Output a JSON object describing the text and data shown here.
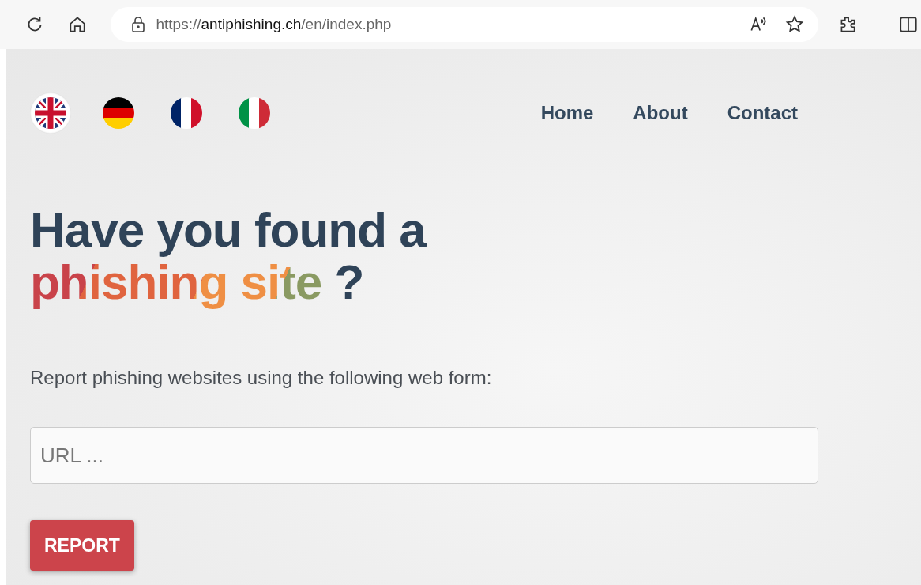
{
  "browser": {
    "url": {
      "scheme": "https://",
      "host": "antiphishing.ch",
      "path": "/en/index.php"
    }
  },
  "languages": [
    {
      "kind": "union",
      "selected": true
    },
    {
      "kind": "horizontal",
      "selected": false
    },
    {
      "kind": "vertical_blue",
      "selected": false
    },
    {
      "kind": "vertical_green",
      "selected": false
    }
  ],
  "nav": [
    "Home",
    "About",
    "Contact"
  ],
  "headline": {
    "line_1": "Have you found a",
    "highlight": "phishing site",
    "end": "?"
  },
  "intro": "Report phishing websites using the following web form:",
  "url_field": {
    "placeholder": "URL ..."
  },
  "submit_button": "REPORT"
}
